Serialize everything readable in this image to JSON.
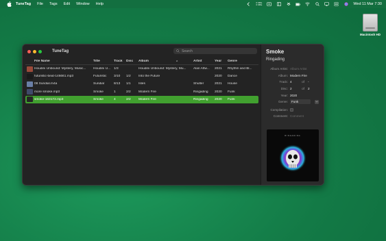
{
  "menubar": {
    "app_name": "TuneTag",
    "items": [
      "File",
      "Tags",
      "Edit",
      "Window",
      "Help"
    ],
    "net_up": "0 KB/s",
    "net_down": "0 KB/s",
    "clock": "Wed 11 Mar  7:30"
  },
  "desktop": {
    "disk_label": "Macintosh HD"
  },
  "window": {
    "title": "TuneTag",
    "search_placeholder": "Search"
  },
  "table": {
    "headers": {
      "file_name": "File Name",
      "title": "Title",
      "track": "Track",
      "disc": "Disc",
      "album": "Album",
      "artist": "Artist",
      "year": "Year",
      "genre": "Genre"
    },
    "rows": [
      {
        "file_name": "Houdini Unbound: Mystery, Music...",
        "title": "Houdini U...",
        "track": "1/3",
        "disc": "",
        "album": "Houdini Unbound: Mystery, Mu...",
        "artist": "Alan Attw...",
        "year": "2021",
        "genre": "Rhythm and Bl...",
        "thumb": "#9b4a3a"
      },
      {
        "file_name": "futuristic-beat-146661.mp3",
        "title": "Futuristic",
        "track": "3/10",
        "disc": "1/2",
        "album": "Into the Future",
        "artist": "",
        "year": "2020",
        "genre": "Dance",
        "thumb": "#1a1a1a"
      },
      {
        "file_name": "08 Sundial.m4a",
        "title": "Sundial",
        "track": "8/13",
        "disc": "1/1",
        "album": "Isles",
        "artist": "Shulter",
        "year": "2021",
        "genre": "House",
        "thumb": "#6a7fa6"
      },
      {
        "file_name": "more smoke.mp3",
        "title": "Smoke",
        "track": "1",
        "disc": "2/2",
        "album": "Modern Fire",
        "artist": "Ringading",
        "year": "2020",
        "genre": "Funk",
        "thumb": "#404a6a"
      },
      {
        "file_name": "smoke-163172.mp3",
        "title": "Smoke",
        "track": "4",
        "disc": "2/2",
        "album": "Modern Fire",
        "artist": "Ringading",
        "year": "2020",
        "genre": "Funk",
        "thumb": "#252525"
      }
    ]
  },
  "inspector": {
    "title": "Smoke",
    "artist": "Ringading",
    "album_artist_label": "Album Artist:",
    "album_artist_placeholder": "Album Artist",
    "album_label": "Album:",
    "album_value": "Modern Fire",
    "track_label": "Track:",
    "track_value": "4",
    "track_total": "-",
    "disc_label": "Disc:",
    "disc_value": "2",
    "disc_total": "2",
    "of_label": "of",
    "year_label": "Year:",
    "year_value": "2020",
    "genre_label": "Genre:",
    "genre_value": "Funk",
    "compilation_label": "Compilation:",
    "comment_label": "Comment:",
    "comment_placeholder": "Comment",
    "artwork_text": "RINGADING"
  },
  "colors": {
    "selection": "#41a02f",
    "desktop": "#137a46",
    "window_bg": "#232323"
  }
}
